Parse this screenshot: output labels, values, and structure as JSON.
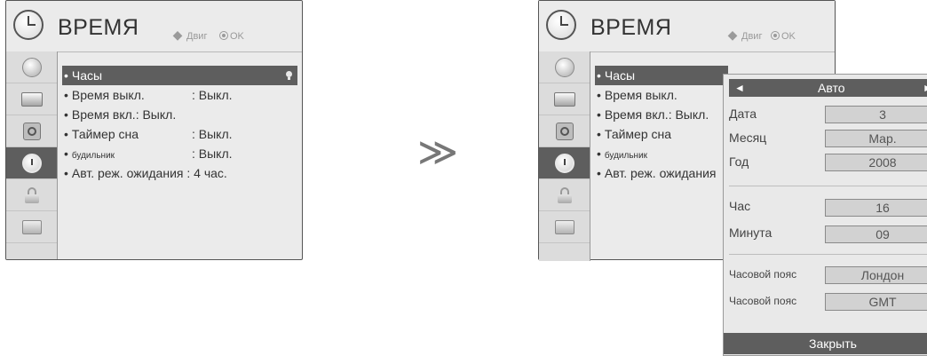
{
  "left_panel": {
    "title": "ВРЕМЯ",
    "hints": {
      "move_label": "Двиг",
      "ok_label": "OK"
    },
    "menu": [
      {
        "label": "Часы",
        "value": ""
      },
      {
        "label": "Время выкл.",
        "value": ": Выкл."
      },
      {
        "label": "Время вкл.: Выкл.",
        "value": ""
      },
      {
        "label": "Таймер сна",
        "value": ": Выкл."
      },
      {
        "label": "будильник",
        "value": ": Выкл."
      },
      {
        "label": "Авт. реж. ожидания : 4 час.",
        "value": ""
      }
    ],
    "bullet": "•"
  },
  "separator": "≫",
  "right_panel": {
    "title": "ВРЕМЯ",
    "hints": {
      "move_label": "Двиг",
      "ok_label": "OK"
    },
    "menu": [
      {
        "label": "Часы"
      },
      {
        "label": "Время выкл."
      },
      {
        "label": "Время вкл.: Выкл."
      },
      {
        "label": "Таймер сна"
      },
      {
        "label": "будильник"
      },
      {
        "label": "Авт. реж. ожидания"
      }
    ],
    "bullet": "•",
    "popup": {
      "mode": {
        "left_arrow": "◄",
        "value": "Авто",
        "right_arrow": "►"
      },
      "fields": [
        {
          "label": "Дата",
          "value": "3"
        },
        {
          "label": "Месяц",
          "value": "Мар."
        },
        {
          "label": "Год",
          "value": "2008"
        },
        {
          "label": "Час",
          "value": "16"
        },
        {
          "label": "Минута",
          "value": "09"
        },
        {
          "label": "Часовой пояс",
          "value": "Лондон"
        },
        {
          "label": "Часовой пояс",
          "value": "GMT"
        }
      ],
      "close_label": "Закрыть"
    }
  },
  "colors": {
    "panel_bg": "#ebebeb",
    "sidebar_bg": "#dcdcdc",
    "selection": "#5e5e5e",
    "text": "#333333",
    "hint_text": "#9a9a9a"
  }
}
